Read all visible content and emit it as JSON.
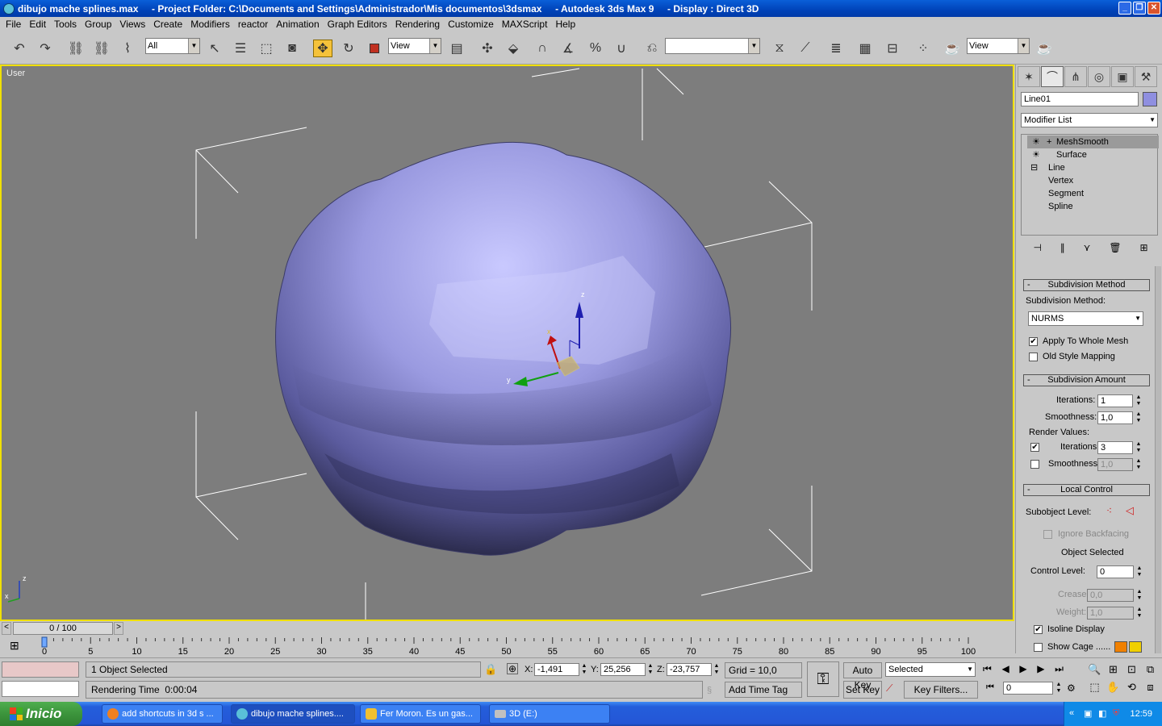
{
  "window": {
    "title": "dibujo mache splines.max     - Project Folder: C:\\Documents and Settings\\Administrador\\Mis documentos\\3dsmax     - Autodesk 3ds Max 9     - Display : Direct 3D"
  },
  "menu": [
    "File",
    "Edit",
    "Tools",
    "Group",
    "Views",
    "Create",
    "Modifiers",
    "reactor",
    "Animation",
    "Graph Editors",
    "Rendering",
    "Customize",
    "MAXScript",
    "Help"
  ],
  "toolbar": {
    "selection_filter": "All",
    "ref_coord": "View",
    "named_selection": "",
    "view_combo": "View"
  },
  "viewport": {
    "label": "User",
    "gizmo": {
      "x": "x",
      "y": "y",
      "z": "z"
    },
    "axis": {
      "x": "x",
      "z": "z"
    }
  },
  "command_panel": {
    "object_name": "Line01",
    "object_color": "#8f8fe0",
    "modifier_list": "Modifier List",
    "stack": [
      "MeshSmooth",
      "Surface",
      "Line",
      "Vertex",
      "Segment",
      "Spline"
    ],
    "subdivision_method": {
      "title": "Subdivision Method",
      "label": "Subdivision Method:",
      "value": "NURMS",
      "apply_whole": "Apply To Whole Mesh",
      "old_style": "Old Style Mapping"
    },
    "subdivision_amount": {
      "title": "Subdivision Amount",
      "iterations_label": "Iterations:",
      "iterations": "1",
      "smoothness_label": "Smoothness:",
      "smoothness": "1,0",
      "render_values": "Render Values:",
      "r_iterations_label": "Iterations:",
      "r_iterations": "3",
      "r_smoothness_label": "Smoothness:",
      "r_smoothness": "1,0"
    },
    "local_control": {
      "title": "Local Control",
      "subobject_label": "Subobject Level:",
      "ignore_backfacing": "Ignore Backfacing",
      "object_selected": "Object Selected",
      "control_level_label": "Control Level:",
      "control_level": "0",
      "crease_label": "Crease:",
      "crease": "0,0",
      "weight_label": "Weight:",
      "weight": "1,0",
      "isoline": "Isoline Display",
      "show_cage": "Show Cage ......"
    }
  },
  "timeline": {
    "frame": "0 / 100",
    "ticks": [
      "0",
      "5",
      "10",
      "15",
      "20",
      "25",
      "30",
      "35",
      "40",
      "45",
      "50",
      "55",
      "60",
      "65",
      "70",
      "75",
      "80",
      "85",
      "90",
      "95",
      "100"
    ]
  },
  "status": {
    "selected": "1 Object Selected",
    "rendering_time": "Rendering Time  0:00:04",
    "x_label": "X:",
    "x": "-1,491",
    "y_label": "Y:",
    "y": "25,256",
    "z_label": "Z:",
    "z": "-23,757",
    "grid": "Grid = 10,0",
    "add_time_tag": "Add Time Tag",
    "auto_key": "Auto Key",
    "set_key": "Set Key",
    "selected_combo": "Selected",
    "key_filters": "Key Filters...",
    "current_frame": "0"
  },
  "taskbar": {
    "start": "Inicio",
    "tasks": [
      "add shortcuts in 3d s ...",
      "dibujo mache splines....",
      "Fer Moron. Es un gas...",
      "3D (E:)"
    ],
    "clock": "12:59"
  }
}
